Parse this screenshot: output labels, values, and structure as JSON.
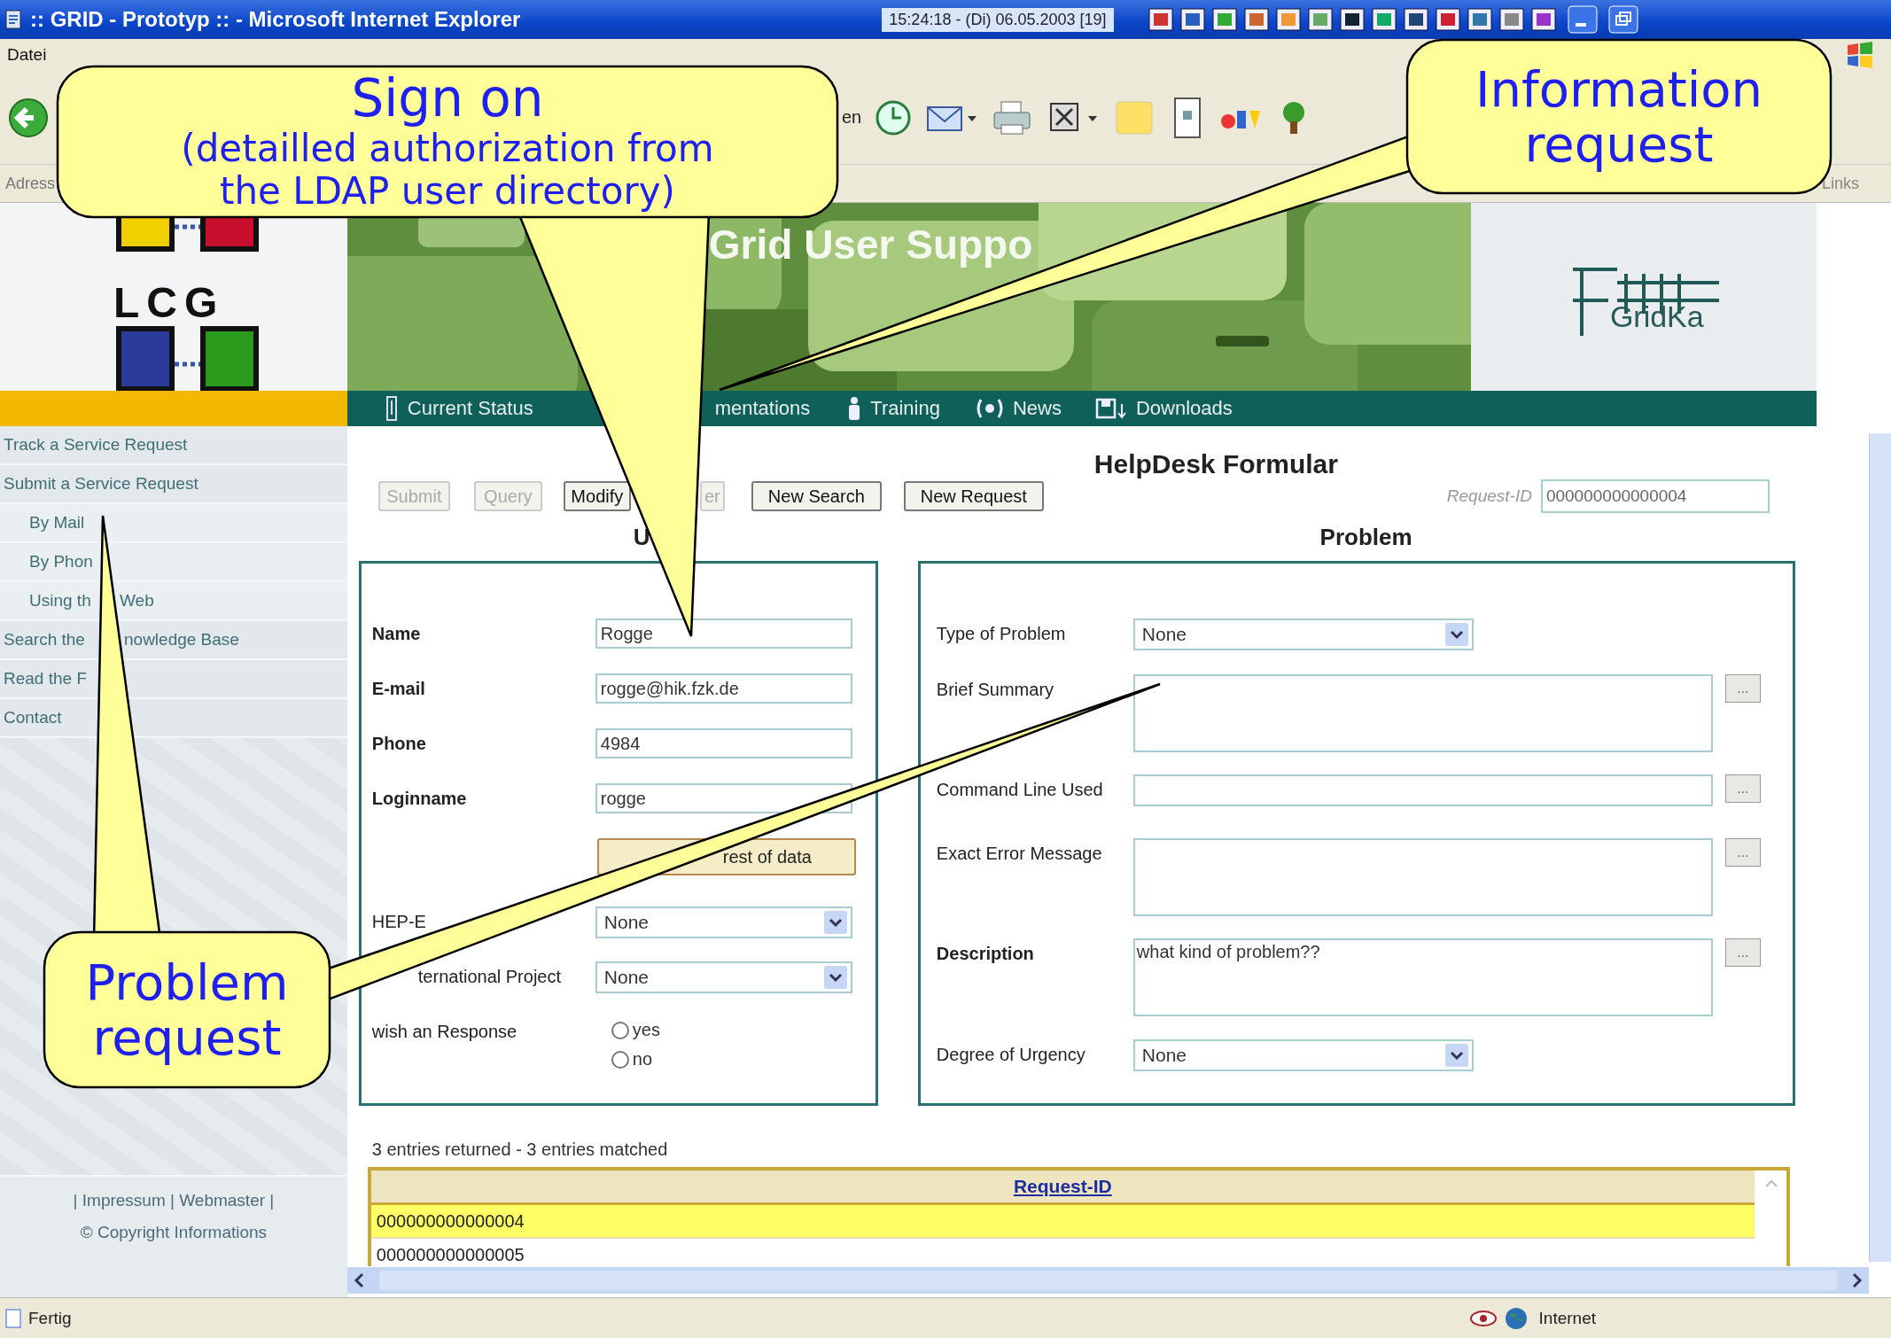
{
  "window": {
    "title": ":: GRID - Prototyp :: - Microsoft Internet Explorer",
    "clock": "15:24:18 - (Di) 06.05.2003 [19]"
  },
  "menu": [
    "Datei"
  ],
  "toolbar": {
    "label_fragment": "en"
  },
  "address_bar": {
    "label": "Adress",
    "links": "Links"
  },
  "header": {
    "logo": "LCG",
    "banner_title": "Grid User Suppo",
    "partner_logo": "GridKa"
  },
  "nav": [
    {
      "kind": "status",
      "label": "Current Status"
    },
    {
      "kind": "plain",
      "label": "mentations"
    },
    {
      "kind": "training",
      "label": "Training"
    },
    {
      "kind": "news",
      "label": "News"
    },
    {
      "kind": "downloads",
      "label": "Downloads"
    }
  ],
  "sidebar": {
    "items": [
      {
        "label": "Track a Service Request"
      },
      {
        "label": "Submit a Service Request",
        "children": [
          {
            "label": "By Mail"
          },
          {
            "label": "By Phon"
          },
          {
            "label": "Using th",
            "label_after": "Web"
          }
        ]
      },
      {
        "label": "Search the",
        "label_after": "nowledge Base"
      },
      {
        "label": "Read the F"
      },
      {
        "label": "Contact"
      }
    ],
    "footer_links": "| Impressum | Webmaster |",
    "copyright": "© Copyright Informations"
  },
  "form": {
    "title": "HelpDesk Formular",
    "buttons": [
      {
        "label": "Submit",
        "disabled": true
      },
      {
        "label": "Query",
        "disabled": true
      },
      {
        "label": "Modify",
        "disabled": false
      },
      {
        "label": "er",
        "disabled": true
      },
      {
        "label": "New Search",
        "disabled": false
      },
      {
        "label": "New Request",
        "disabled": false
      }
    ],
    "request_id": {
      "label": "Request-ID",
      "value": "000000000000004"
    },
    "user": {
      "heading": "U",
      "fields": [
        {
          "kind": "text",
          "label": "Name",
          "value": "Rogge",
          "bold": true
        },
        {
          "kind": "text",
          "label": "E-mail",
          "value": "rogge@hik.fzk.de",
          "bold": true
        },
        {
          "kind": "text",
          "label": "Phone",
          "value": "4984",
          "bold": true
        },
        {
          "kind": "text",
          "label": "Loginname",
          "value": "rogge",
          "bold": true
        },
        {
          "kind": "button",
          "label": "rest of data"
        },
        {
          "kind": "select",
          "label": "HEP-E",
          "value": "None",
          "bold": false
        },
        {
          "kind": "select",
          "label": "ternational Project",
          "value": "None",
          "bold": false
        },
        {
          "kind": "radio",
          "label": "wish an Response",
          "bold": false,
          "options": [
            {
              "label": "yes",
              "checked": false
            },
            {
              "label": "no",
              "checked": false
            }
          ]
        }
      ]
    },
    "problem": {
      "heading": "Problem",
      "fields": [
        {
          "kind": "select",
          "label": "Type of Problem",
          "value": "None",
          "bold": false
        },
        {
          "kind": "textarea",
          "label": "Brief Summary",
          "bold": false,
          "expand": "..."
        },
        {
          "kind": "line",
          "label": "Command Line Used",
          "bold": false,
          "expand": "..."
        },
        {
          "kind": "textarea",
          "label": "Exact Error Message",
          "bold": false,
          "expand": "..."
        },
        {
          "kind": "textarea",
          "label": "Description",
          "value": "what kind of problem??",
          "bold": true,
          "expand": "..."
        },
        {
          "kind": "select",
          "label": "Degree of Urgency",
          "value": "None",
          "bold": false
        }
      ]
    }
  },
  "results": {
    "summary": "3 entries returned - 3 entries matched",
    "column": "Request-ID",
    "rows": [
      {
        "id": "000000000000004",
        "selected": true
      },
      {
        "id": "000000000000005",
        "selected": false
      }
    ]
  },
  "status_bar": {
    "text": "Fertig",
    "zone": "Internet"
  },
  "callouts": [
    {
      "title": "Sign on",
      "detail": "(detailled authorization from the LDAP user directory)"
    },
    {
      "title": "Information request"
    },
    {
      "title": "Problem request"
    }
  ]
}
